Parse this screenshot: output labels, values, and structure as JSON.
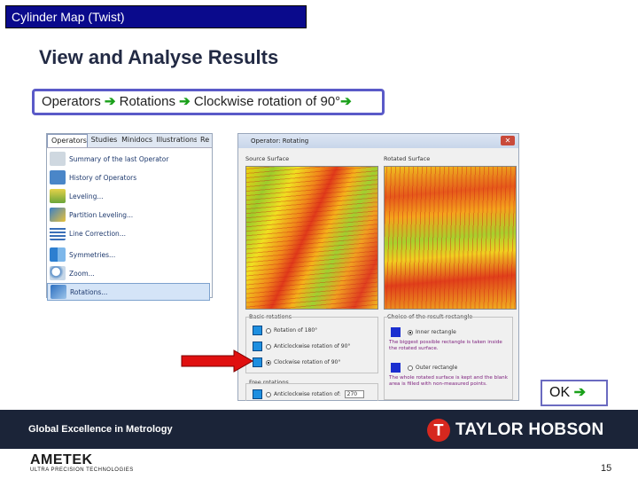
{
  "slide": {
    "section_title": "Cylinder Map (Twist)",
    "heading": "View and Analyse Results",
    "steps": {
      "step1": "Operators ",
      "step2": " Rotations ",
      "step3": " Clockwise rotation of 90°",
      "arrow": "➔"
    },
    "ok_label": "OK ",
    "page_number": "15"
  },
  "menu": {
    "tabs": [
      "Operators",
      "Studies",
      "Minidocs",
      "Illustrations",
      "Re"
    ],
    "items": [
      "Summary of the last Operator",
      "History of Operators",
      "Leveling...",
      "Partition Leveling...",
      "Line Correction...",
      "Symmetries...",
      "Zoom...",
      "Rotations..."
    ],
    "selected_index": 7
  },
  "dialog": {
    "title": "Operator: Rotating",
    "source_label": "Source Surface",
    "rotated_label": "Rotated Surface",
    "basic_title": "Basic rotations",
    "basic_options": [
      "Rotation of 180°",
      "Anticlockwise rotation of 90°",
      "Clockwise rotation of 90°"
    ],
    "basic_selected": 2,
    "free_title": "Free rotations",
    "free_option": "Anticlockwise rotation of:",
    "free_angle": "270",
    "choice_title": "Choice of the result rectangle",
    "choice_options": [
      "Inner rectangle",
      "Outer rectangle"
    ],
    "choice_selected": 0,
    "info_inner": "The biggest possible rectangle is taken inside the rotated surface.",
    "info_outer": "The whole rotated surface is kept and the blank area is filled with non-measured points."
  },
  "footer": {
    "tagline": "Global Excellence in Metrology",
    "brand": "TAYLOR HOBSON",
    "brand_mark": "T",
    "ametek_name": "AMETEK",
    "ametek_tagline": "ULTRA PRECISION TECHNOLOGIES"
  },
  "colors": {
    "title_bar": "#0a0a8c",
    "step_arrow": "#1aa01a",
    "red_arrow": "#e01010",
    "footer_bg": "#1b2438",
    "brand_red": "#d6281f"
  }
}
